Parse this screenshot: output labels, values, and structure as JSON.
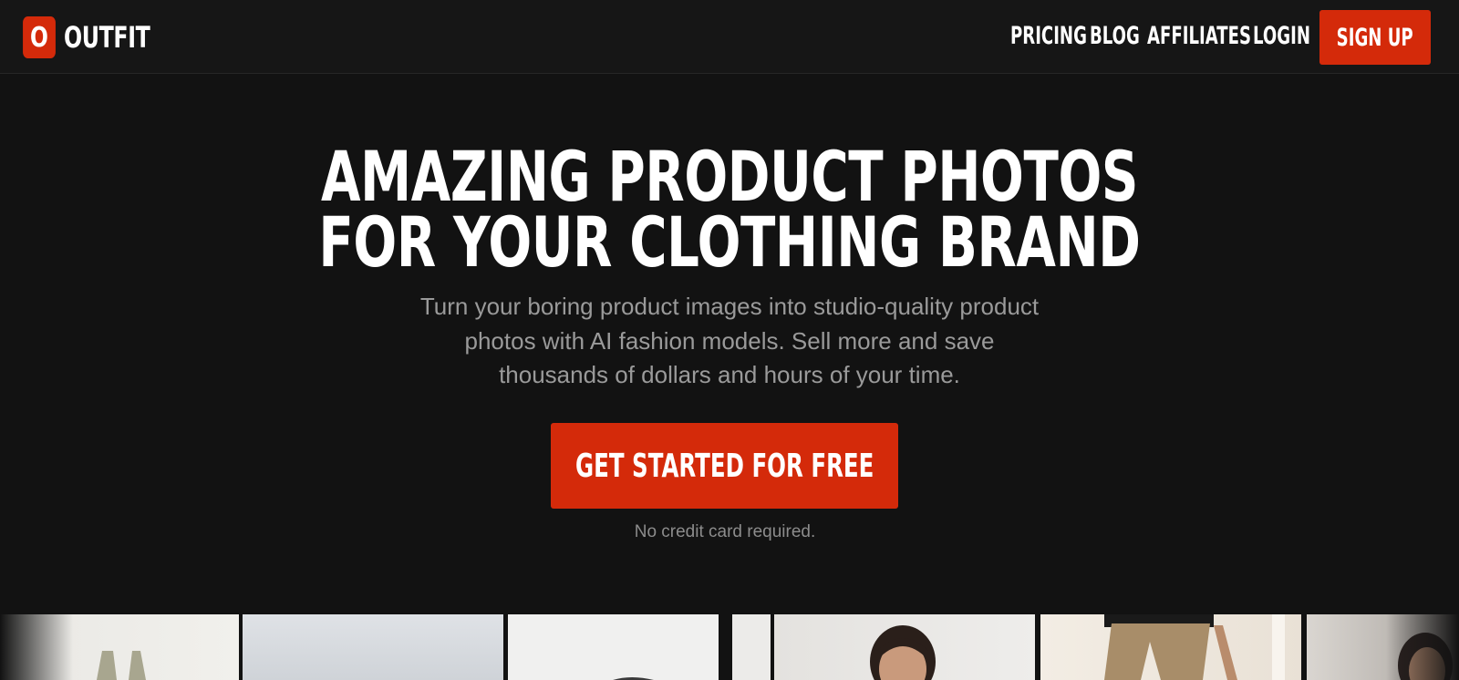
{
  "brand": {
    "mark": "O",
    "name": "OUTFIT",
    "accent": "#d42a0a"
  },
  "nav": {
    "links": [
      "PRICING",
      "BLOG",
      "AFFILIATES",
      "LOGIN"
    ],
    "signup": "SIGN UP"
  },
  "hero": {
    "title_line1": "AMAZING PRODUCT PHOTOS",
    "title_line2": "FOR YOUR CLOTHING BRAND",
    "subtitle": "Turn your boring product images into studio-quality product photos with AI fashion models. Sell more and save thousands of dollars and hours of your time.",
    "cta": "GET STARTED FOR FREE",
    "note": "No credit card required."
  },
  "gallery": {
    "images": [
      "tank-top-photo",
      "grey-backdrop-photo",
      "dark-garment-photo",
      "white-backdrop-photo",
      "woman-model-photo",
      "khaki-pants-model-photo",
      "model-portrait-photo"
    ]
  }
}
